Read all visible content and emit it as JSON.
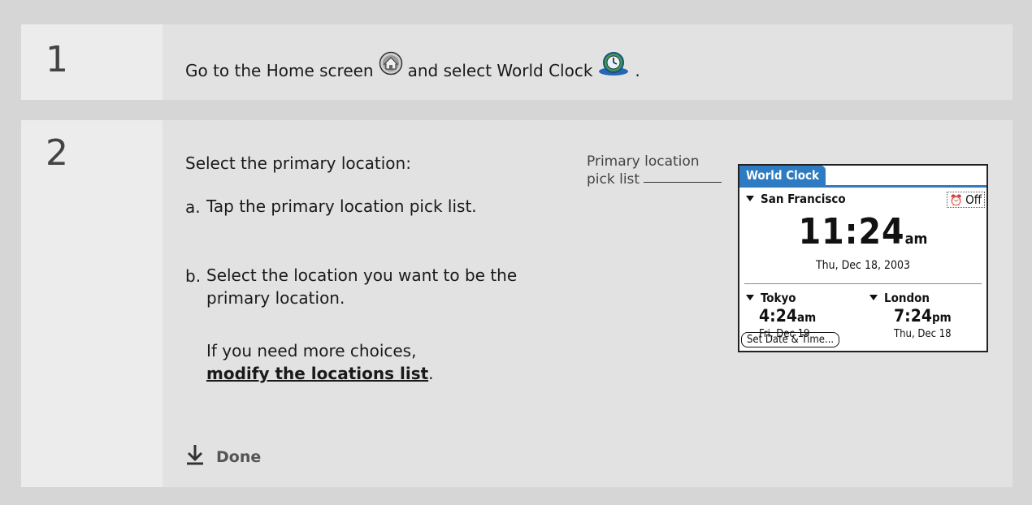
{
  "steps": [
    {
      "number": "1",
      "text_before": "Go to the Home screen",
      "text_middle": "and select World Clock",
      "text_after": "."
    },
    {
      "number": "2",
      "intro": "Select the primary location:",
      "items": [
        {
          "marker": "a.",
          "text": "Tap the primary location pick list."
        },
        {
          "marker": "b.",
          "text": "Select the location you want to be the primary location."
        }
      ],
      "more_text": "If you need more choices,",
      "link_text": "modify the locations list",
      "link_suffix": ".",
      "done_label": "Done"
    }
  ],
  "callout": {
    "line1": "Primary location",
    "line2": "pick list"
  },
  "palm": {
    "title": "World Clock",
    "primary_location": "San Francisco",
    "alarm": "Off",
    "time": "11:24",
    "ampm": "am",
    "date": "Thu, Dec 18, 2003",
    "secondary": [
      {
        "location": "Tokyo",
        "time": "4:24",
        "ampm": "am",
        "date": "Fri, Dec 19"
      },
      {
        "location": "London",
        "time": "7:24",
        "ampm": "pm",
        "date": "Thu, Dec 18"
      }
    ],
    "button": "Set Date & Time..."
  },
  "icons": [
    "home-icon",
    "world-clock-icon",
    "done-arrow-icon",
    "alarm-clock-icon"
  ],
  "colors": {
    "accent": "#2e7bc2",
    "background": "#d6d6d6",
    "panel": "#e2e2e2",
    "number_panel": "#ececec"
  }
}
